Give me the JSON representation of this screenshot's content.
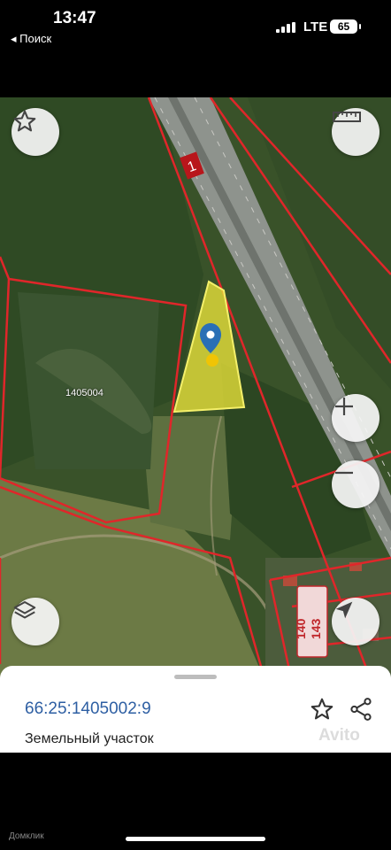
{
  "status_bar": {
    "time": "13:47",
    "back_label": "◂ Поиск",
    "network": "LTE",
    "battery": "65"
  },
  "map": {
    "road_number": "1",
    "parcel_labels": [
      "1405004"
    ],
    "house_numbers": [
      "140",
      "143"
    ],
    "buttons": {
      "favorite": "star-icon",
      "ruler": "ruler-icon",
      "zoom_in": "plus-icon",
      "zoom_out": "minus-icon",
      "layers": "layers-icon",
      "locate": "navigation-arrow-icon"
    },
    "colors": {
      "boundary": "#e0262a",
      "selected_fill": "#e6e03a",
      "pin": "#2a6fb5"
    }
  },
  "sheet": {
    "cadastral_number": "66:25:1405002:9",
    "object_type": "Земельный участок",
    "watermark": "Avito"
  },
  "footer": {
    "brand": "Домклик"
  }
}
